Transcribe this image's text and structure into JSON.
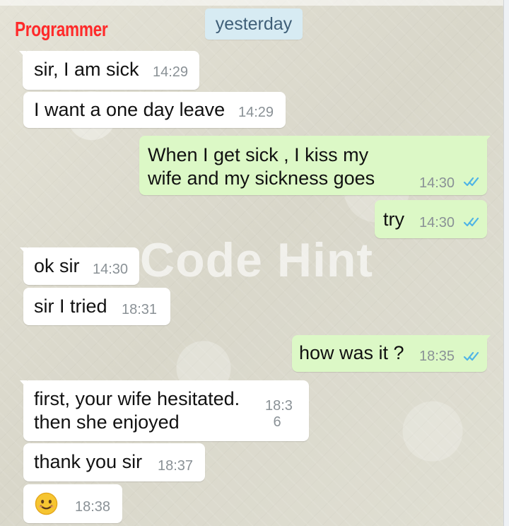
{
  "header": {
    "brand": "Programmer",
    "date_chip": "yesterday",
    "watermark": "Code Hint"
  },
  "theme": {
    "brand_color": "#ff2a2a",
    "incoming_bubble": "#ffffff",
    "outgoing_bubble": "#dcf8c6",
    "read_receipt": "#4fb4e6",
    "date_chip": "#d7ebf3"
  },
  "messages": [
    {
      "direction": "incoming",
      "text": "sir, I am sick",
      "time": "14:29"
    },
    {
      "direction": "incoming",
      "text": "I want a one day leave",
      "time": "14:29"
    },
    {
      "direction": "outgoing",
      "text": "When I get sick , I kiss my wife and my sickness goes",
      "time": "14:30",
      "status_icon": "double-check-icon"
    },
    {
      "direction": "outgoing",
      "text": "try",
      "time": "14:30",
      "status_icon": "double-check-icon"
    },
    {
      "direction": "incoming",
      "text": "ok sir",
      "time": "14:30"
    },
    {
      "direction": "incoming",
      "text": "sir I tried",
      "time": "18:31"
    },
    {
      "direction": "outgoing",
      "text": "how was it ?",
      "time": "18:35",
      "status_icon": "double-check-icon"
    },
    {
      "direction": "incoming",
      "text": "first, your wife hesitated. then she enjoyed",
      "time": "18:3\n6"
    },
    {
      "direction": "incoming",
      "text": "thank you sir",
      "time": "18:37"
    },
    {
      "direction": "incoming",
      "emoji": "smiling-face-icon",
      "time": "18:38"
    }
  ]
}
